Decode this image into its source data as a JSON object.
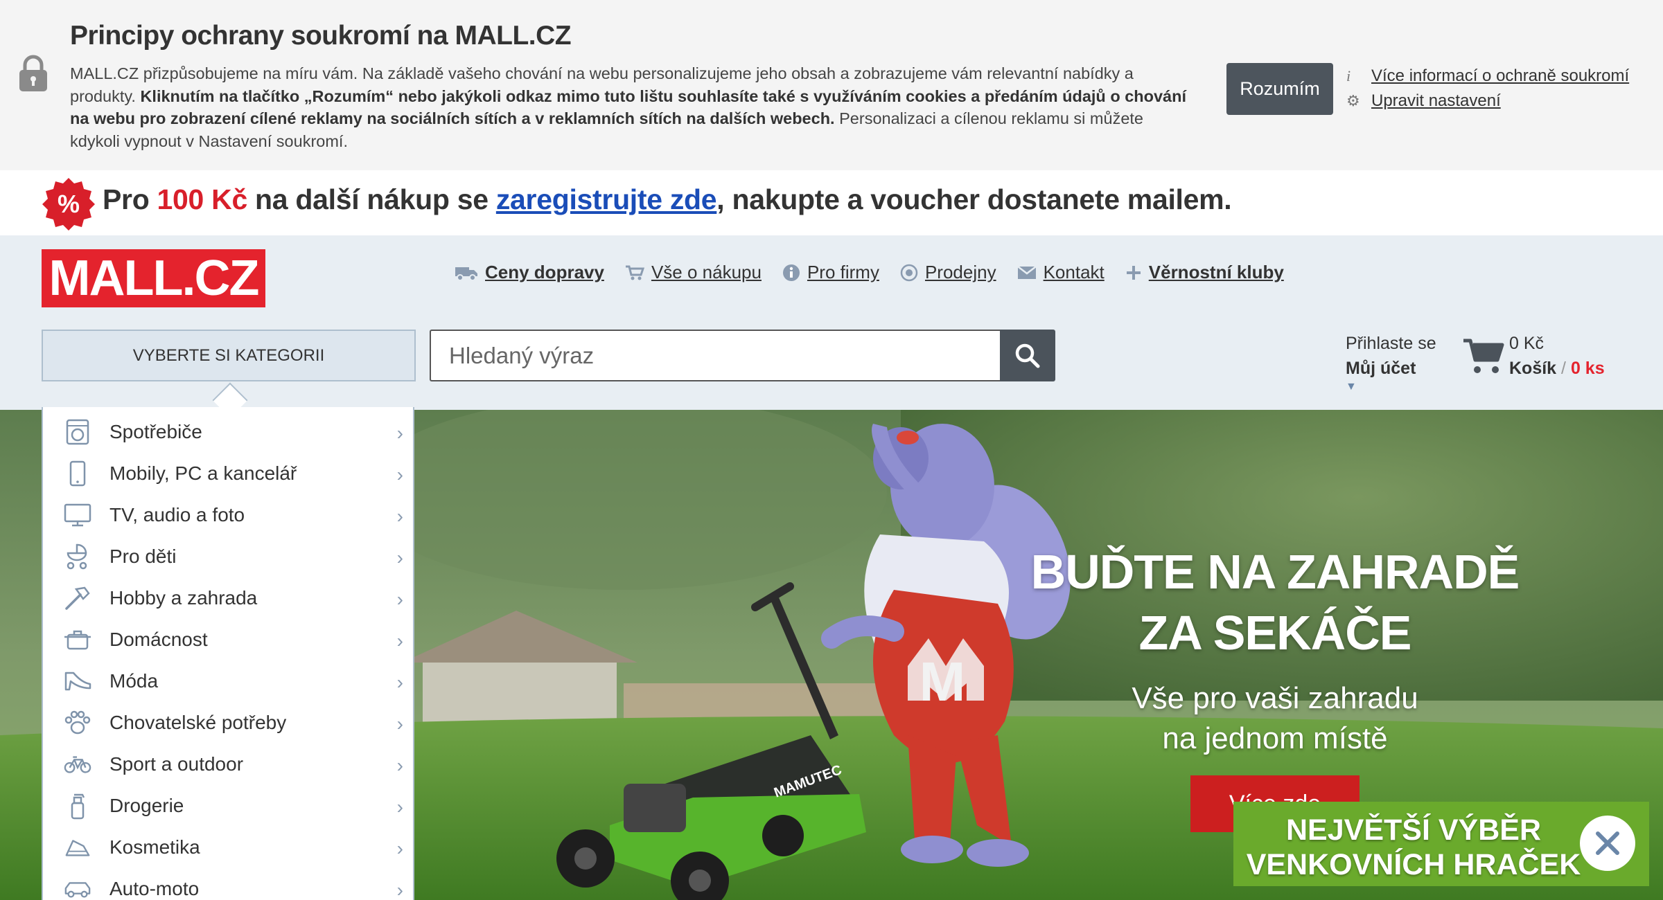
{
  "cookie": {
    "title": "Principy ochrany soukromí na MALL.CZ",
    "text_1": "MALL.CZ přizpůsobujeme na míru vám. Na základě vašeho chování na webu personalizujeme jeho obsah a zobrazujeme vám relevantní nabídky a produkty. ",
    "text_bold": "Kliknutím na tlačítko „Rozumím“ nebo jakýkoli odkaz mimo tuto lištu souhlasíte také s využíváním cookies a předáním údajů o chování na webu pro zobrazení cílené reklamy na sociálních sítích a v reklamních sítích na dalších webech.",
    "text_2": " Personalizaci a cílenou reklamu si můžete kdykoli vypnout v Nastavení soukromí.",
    "accept_label": "Rozumím",
    "more_info_icon": "i",
    "more_info_label": "Více informací o ochraně soukromí",
    "settings_icon": "⚙",
    "settings_label": "Upravit nastavení"
  },
  "promo": {
    "badge": "%",
    "pre": "Pro ",
    "amount": "100 Kč",
    "mid": " na další nákup se ",
    "link": "zaregistrujte zde",
    "post": ", nakupte a voucher dostanete mailem."
  },
  "header": {
    "logo": "MALL.CZ",
    "nav": [
      {
        "label": "Ceny dopravy",
        "icon": "truck-icon",
        "glyph": "🚚",
        "bold": true
      },
      {
        "label": "Vše o nákupu",
        "icon": "cart-icon",
        "glyph": "🛒",
        "bold": false
      },
      {
        "label": "Pro firmy",
        "icon": "info-icon",
        "glyph": "ℹ",
        "bold": false
      },
      {
        "label": "Prodejny",
        "icon": "store-icon",
        "glyph": "◉",
        "bold": false
      },
      {
        "label": "Kontakt",
        "icon": "envelope-icon",
        "glyph": "✉",
        "bold": false
      },
      {
        "label": "Věrnostní kluby",
        "icon": "plus-icon",
        "glyph": "+",
        "bold": true
      }
    ],
    "category_button": "VYBERTE SI KATEGORII",
    "search_placeholder": "Hledaný výraz",
    "account_line1": "Přihlaste se",
    "account_line2": "Můj účet",
    "account_caret": "▼",
    "cart_amount": "0 Kč",
    "cart_label": "Košík",
    "cart_sep": " / ",
    "cart_count": "0 ks"
  },
  "categories": [
    {
      "label": "Spotřebiče",
      "icon": "washing-machine-icon"
    },
    {
      "label": "Mobily, PC a kancelář",
      "icon": "mobile-icon"
    },
    {
      "label": "TV, audio a foto",
      "icon": "tv-icon"
    },
    {
      "label": "Pro děti",
      "icon": "stroller-icon"
    },
    {
      "label": "Hobby a zahrada",
      "icon": "hammer-icon"
    },
    {
      "label": "Domácnost",
      "icon": "pot-icon"
    },
    {
      "label": "Móda",
      "icon": "shoe-icon"
    },
    {
      "label": "Chovatelské potřeby",
      "icon": "paw-icon"
    },
    {
      "label": "Sport a outdoor",
      "icon": "bicycle-icon"
    },
    {
      "label": "Drogerie",
      "icon": "spray-icon"
    },
    {
      "label": "Kosmetika",
      "icon": "cosmetics-icon"
    },
    {
      "label": "Auto-moto",
      "icon": "car-icon"
    }
  ],
  "hero": {
    "title_line1": "BUĎTE NA ZAHRADĚ",
    "title_line2": "ZA SEKÁČE",
    "sub_line1": "Vše pro vaši zahradu",
    "sub_line2": "na jednom místě",
    "cta": "Více zde",
    "mascot_letter": "M",
    "mower_brand": "MAMUTEC"
  },
  "popup": {
    "line1": "NEJVĚTŠÍ VÝBĚR",
    "line2": "VENKOVNÍCH HRAČEK"
  },
  "colors": {
    "brand_red": "#e4232d",
    "button_dark": "#4d555d",
    "header_bg": "#e8eef3",
    "link_blue": "#1a4db8",
    "popup_green": "#6aaa2c"
  }
}
